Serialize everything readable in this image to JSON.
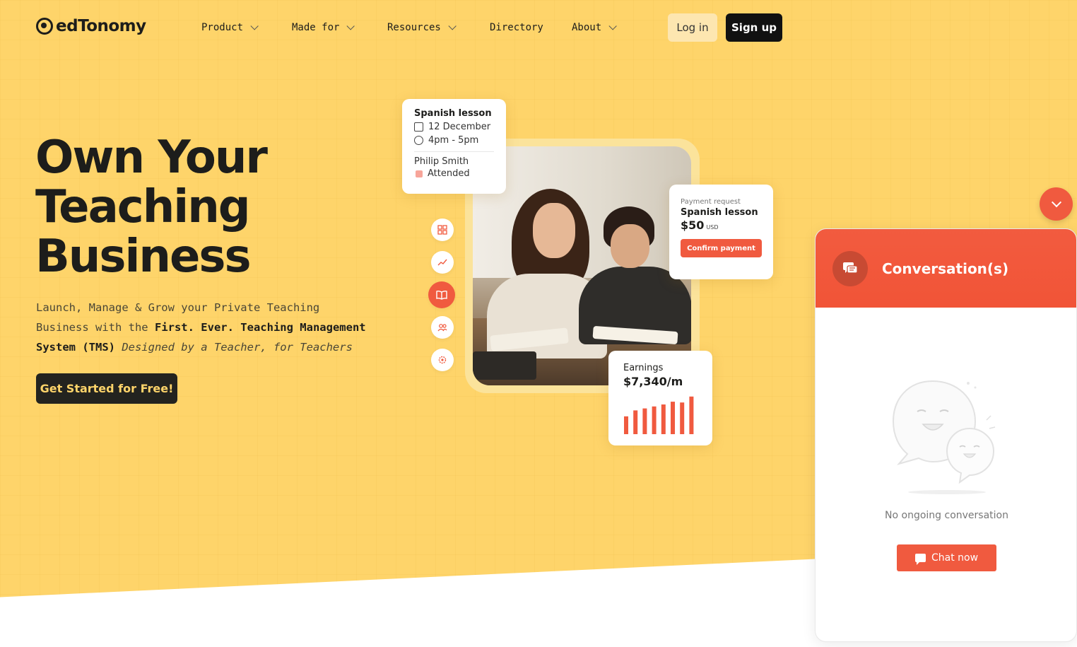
{
  "brand": {
    "name": "edTonomy"
  },
  "nav": {
    "items": [
      {
        "label": "Product",
        "has_dropdown": true
      },
      {
        "label": "Made for",
        "has_dropdown": true
      },
      {
        "label": "Resources",
        "has_dropdown": true
      },
      {
        "label": "Directory",
        "has_dropdown": false
      },
      {
        "label": "About",
        "has_dropdown": true
      }
    ],
    "login": "Log in",
    "signup": "Sign up"
  },
  "hero": {
    "headline": [
      "Own Your",
      "Teaching",
      "Business"
    ],
    "sub_part1": "Launch, Manage & Grow your Private Teaching Business with the ",
    "sub_bold": "First. Ever. Teaching Management System (TMS)",
    "sub_italic": " Designed by a Teacher, for Teachers",
    "cta": "Get Started for Free!"
  },
  "lesson_card": {
    "title": "Spanish lesson",
    "date": "12 December",
    "time": "4pm - 5pm",
    "student": "Philip Smith",
    "status": "Attended"
  },
  "payment_card": {
    "label": "Payment request",
    "title": "Spanish lesson",
    "amount": "$50",
    "currency": "USD",
    "button": "Confirm payment"
  },
  "earnings_card": {
    "label": "Earnings",
    "amount": "$7,340/m",
    "bars": [
      0.45,
      0.6,
      0.65,
      0.7,
      0.75,
      0.82,
      0.8,
      0.95
    ]
  },
  "side_icons": [
    "grid-icon",
    "trend-icon",
    "book-icon",
    "users-icon",
    "settings-icon"
  ],
  "chat": {
    "title": "Conversation(s)",
    "empty_text": "No ongoing conversation",
    "button": "Chat now"
  },
  "colors": {
    "accent": "#f05a3f",
    "hero_bg": "#fed46a",
    "dark": "#1d1d1b"
  }
}
